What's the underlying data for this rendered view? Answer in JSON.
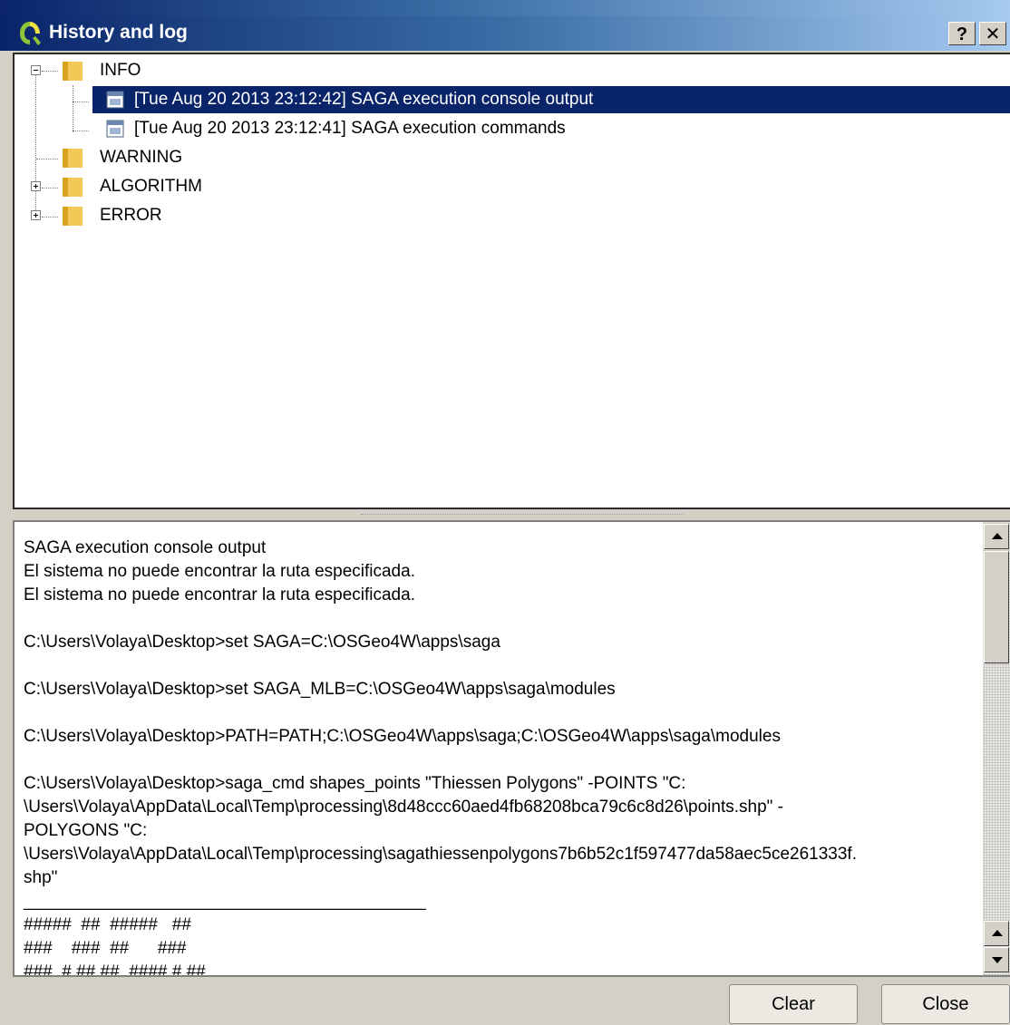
{
  "window": {
    "title": "History and log",
    "help_label": "?",
    "close_label": "✕"
  },
  "tree": {
    "groups": [
      {
        "label": "INFO",
        "expanded": true
      },
      {
        "label": "WARNING",
        "expanded": false
      },
      {
        "label": "ALGORITHM",
        "expanded": false
      },
      {
        "label": "ERROR",
        "expanded": false
      }
    ],
    "info_entries": [
      {
        "label": "[Tue Aug 20 2013 23:12:42] SAGA execution console output",
        "selected": true
      },
      {
        "label": "[Tue Aug 20 2013 23:12:41] SAGA execution commands",
        "selected": false
      }
    ]
  },
  "log": {
    "text": "SAGA execution console output\nEl sistema no puede encontrar la ruta especificada.\nEl sistema no puede encontrar la ruta especificada.\n\nC:\\Users\\Volaya\\Desktop>set SAGA=C:\\OSGeo4W\\apps\\saga\n\nC:\\Users\\Volaya\\Desktop>set SAGA_MLB=C:\\OSGeo4W\\apps\\saga\\modules\n\nC:\\Users\\Volaya\\Desktop>PATH=PATH;C:\\OSGeo4W\\apps\\saga;C:\\OSGeo4W\\apps\\saga\\modules\n\nC:\\Users\\Volaya\\Desktop>saga_cmd shapes_points \"Thiessen Polygons\" -POINTS \"C:\n\\Users\\Volaya\\AppData\\Local\\Temp\\processing\\8d48ccc60aed4fb68208bca79c6c8d26\\points.shp\" -\nPOLYGONS \"C:\n\\Users\\Volaya\\AppData\\Local\\Temp\\processing\\sagathiessenpolygons7b6b52c1f597477da58aec5ce261333f.\nshp\"\n__________________________________________\n#####  ##  #####   ##\n###    ###  ##      ###\n###  # ## ##  #### # ##"
  },
  "buttons": {
    "clear": "Clear",
    "close": "Close"
  },
  "colors": {
    "selection": "#0a246a",
    "titlebar_start": "#0a246a",
    "titlebar_end": "#a6caf0"
  }
}
